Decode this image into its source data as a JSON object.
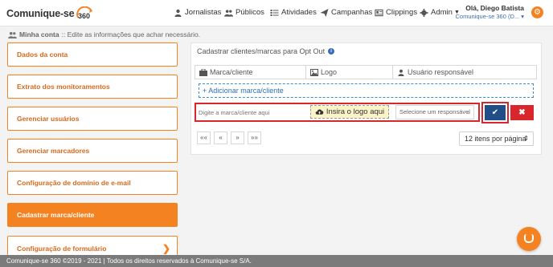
{
  "header": {
    "brand": "Comunique-se",
    "brand_number": "360",
    "nav": [
      {
        "label": "Jornalistas",
        "icon": "user-icon"
      },
      {
        "label": "Públicos",
        "icon": "users-icon"
      },
      {
        "label": "Atividades",
        "icon": "list-icon"
      },
      {
        "label": "Campanhas",
        "icon": "send-icon"
      },
      {
        "label": "Clippings",
        "icon": "newspaper-icon"
      },
      {
        "label": "Admin",
        "icon": "gear-icon"
      }
    ],
    "user_greeting": "Olá, Diego Batista",
    "user_org": "Comunique-se 360 (D...",
    "accent": "#f58220"
  },
  "breadcrumb": {
    "title": "Minha conta",
    "description": ":: Edite as informações que achar necessário."
  },
  "sidebar": {
    "items": [
      {
        "label": "Dados da conta",
        "active": false
      },
      {
        "label": "Extrato dos monitoramentos",
        "active": false
      },
      {
        "label": "Gerenciar usuários",
        "active": false
      },
      {
        "label": "Gerenciar marcadores",
        "active": false
      },
      {
        "label": "Configuração de domínio de e-mail",
        "active": false
      },
      {
        "label": "Cadastrar marca/cliente",
        "active": true
      },
      {
        "label": "Configuração de formulário",
        "active": false
      }
    ]
  },
  "main": {
    "title": "Cadastrar clientes/marcas para Opt Out",
    "columns": [
      "Marca/cliente",
      "Logo",
      "Usuário responsável"
    ],
    "add_label": "+ Adicionar marca/cliente",
    "brand_placeholder": "Digite a marca/cliente aqui",
    "logo_button": "Insira o logo aqui",
    "responsible_placeholder": "Selecione um responsável",
    "confirm_icon": "check-icon",
    "cancel_icon": "close-icon",
    "pager": [
      "««",
      "«",
      "»",
      "»»"
    ],
    "per_page": "12 itens por página"
  },
  "footer": {
    "text": "Comunique-se 360 ©2019 - 2021 | Todos os direitos reservados à Comunique-se S/A."
  }
}
